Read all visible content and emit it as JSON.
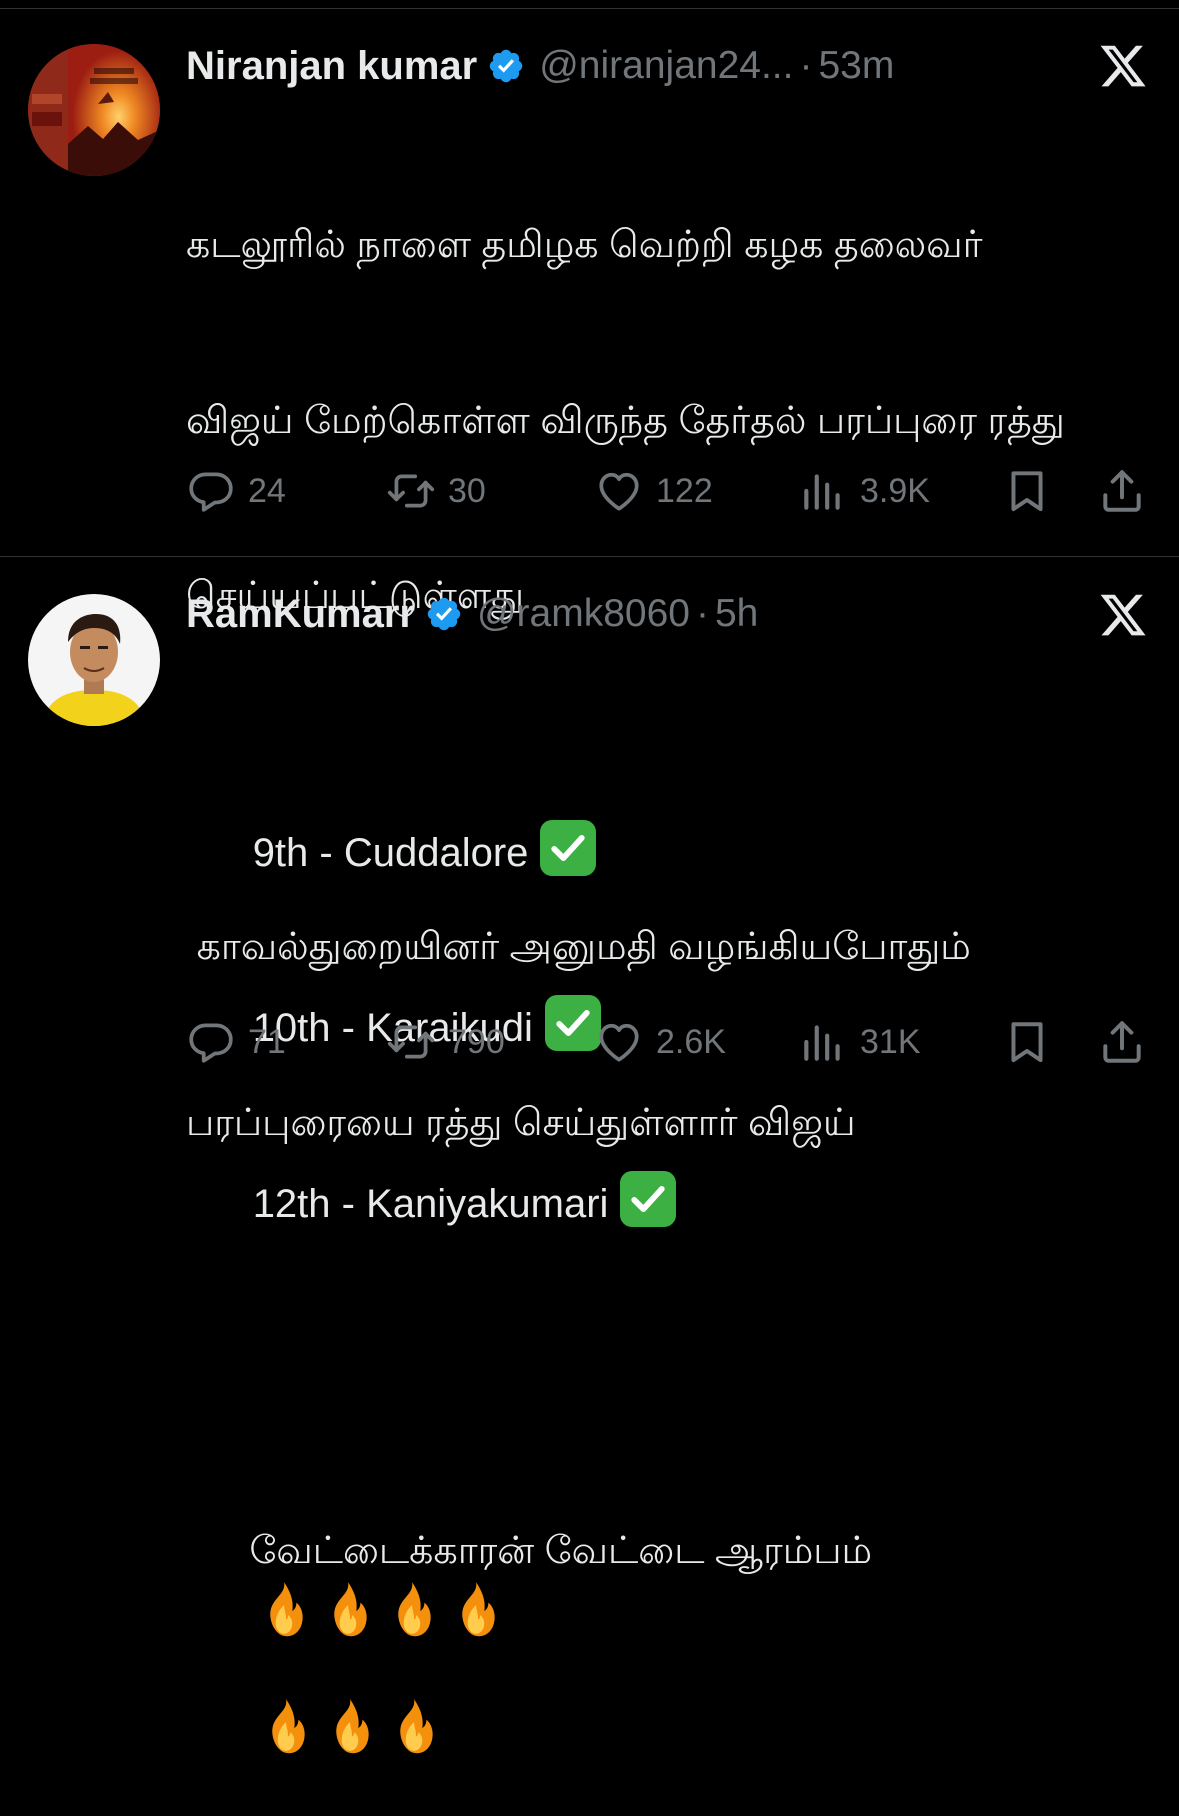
{
  "colors": {
    "background": "#000000",
    "text_primary": "#e7e9ea",
    "text_secondary": "#71767b",
    "verified_blue": "#1d9bf0",
    "divider": "#2f3336",
    "check_green": "#3cb043"
  },
  "tweets": [
    {
      "author": "Niranjan kumar",
      "verified": true,
      "handle": "@niranjan24...",
      "separator": "·",
      "time": "53m",
      "body_lines": [
        "கடலூரில் நாளை தமிழக வெற்றி கழக தலைவர்",
        "விஜய் மேற்கொள்ள விருந்த தேர்தல் பரப்புரை ரத்து",
        "செய்யப்பட்டுள்ளது",
        "",
        " காவல்துறையினர் அனுமதி வழங்கியபோதும்",
        "பரப்புரையை ரத்து செய்துள்ளார் விஜய்"
      ],
      "stats": {
        "replies": "24",
        "reposts": "30",
        "likes": "122",
        "views": "3.9K"
      }
    },
    {
      "author": "RamKumarr",
      "verified": true,
      "handle": "@ramk8060",
      "separator": "·",
      "time": "5h",
      "body_lines": [
        "9th - Cuddalore",
        "10th - Karaikudi",
        "12th - Kaniyakumari",
        "",
        "வேட்டைக்காரன் வேட்டை ஆரம்பம்",
        ""
      ],
      "check_emoji_lines": [
        0,
        1,
        2
      ],
      "fire_emoji_count_line5": 4,
      "fire_emoji_count_line6": 3,
      "stats": {
        "replies": "71",
        "reposts": "790",
        "likes": "2.6K",
        "views": "31K"
      }
    }
  ],
  "icons": {
    "reply": "reply-icon",
    "repost": "repost-icon",
    "like": "heart-icon",
    "views": "views-chart-icon",
    "bookmark": "bookmark-icon",
    "share": "share-icon",
    "platform": "x-logo-icon",
    "verified": "verified-badge-icon",
    "check": "check-mark-button-emoji",
    "fire": "fire-emoji"
  }
}
